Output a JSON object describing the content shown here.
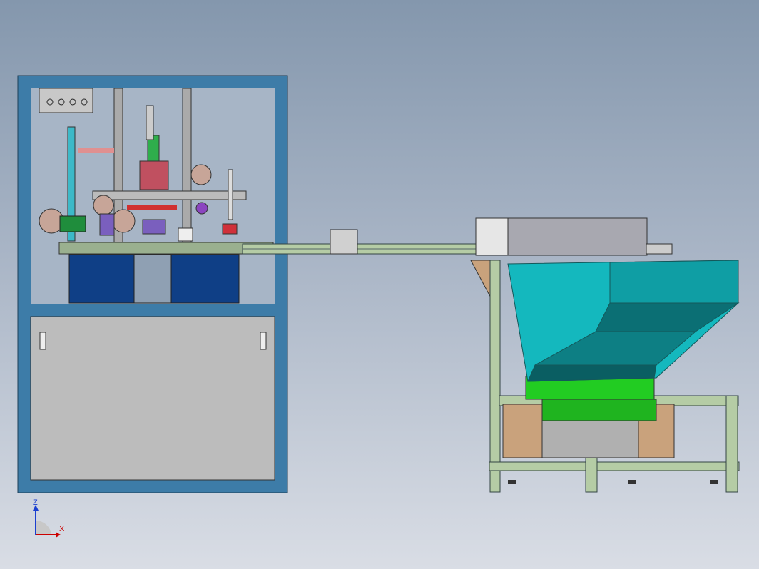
{
  "viewport": {
    "axis_triad": {
      "x_label": "X",
      "z_label": "Z"
    }
  },
  "colors": {
    "frame_blue": "#3d7ca8",
    "panel_gray": "#b8b8b8",
    "hopper_cyan": "#14b8be",
    "hopper_green": "#22cc22",
    "rail_green": "#b5cca5",
    "tan": "#c9a27c"
  }
}
